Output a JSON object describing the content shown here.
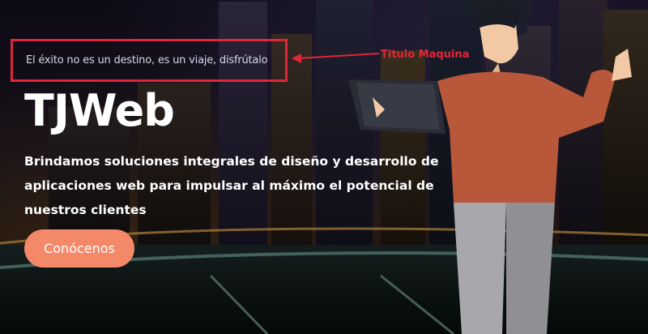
{
  "hero": {
    "tagline": "El éxito no es un destino, es un viaje, disfrútalo",
    "brand": "TJWeb",
    "description": "Brindamos soluciones integrales de diseño y desarrollo de aplicaciones web para impulsar al máximo el potencial de nuestros clientes",
    "cta_label": "Conócenos"
  },
  "annotation": {
    "label": "Titulo Maquina"
  },
  "colors": {
    "annotation_red": "#e0263a",
    "cta_bg": "#f4896a",
    "text_white": "#ffffff"
  }
}
